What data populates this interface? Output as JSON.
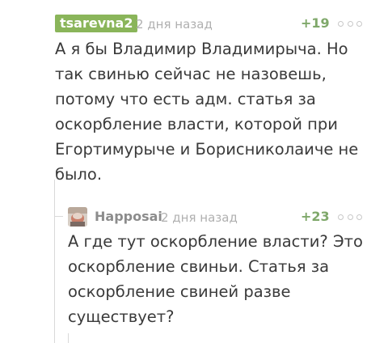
{
  "comments": [
    {
      "author": "tsarevna2",
      "time": "2 дня назад",
      "rating": "+19",
      "text": "А я бы Владимир Владимирыча. Но\nтак свинью сейчас не назовешь,\nпотому что есть адм. статья за\nоскорбление власти, которой при\nЕгортимурыче и Борисниколаиче не\nбыло."
    },
    {
      "author": "Happosai",
      "time": "2 дня назад",
      "rating": "+23",
      "text": "А где тут оскорбление власти? Это\nоскорбление свиньи. Статья за\nоскорбление свиней разве\nсуществует?"
    }
  ],
  "icons": {
    "more": "more-options-icon",
    "avatar": "user-avatar"
  },
  "colors": {
    "author_badge_bg": "#8ab55a",
    "rating": "#7fa86a",
    "muted": "#b0b0b0"
  }
}
